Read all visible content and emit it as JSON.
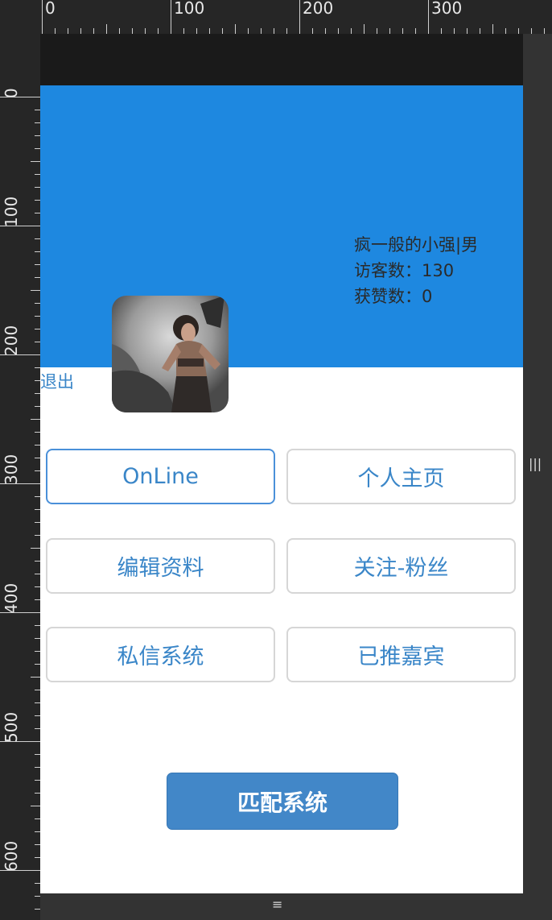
{
  "ruler": {
    "top_labels": [
      "0",
      "100",
      "200",
      "300"
    ],
    "left_labels": [
      "0",
      "100",
      "200",
      "300",
      "400",
      "500",
      "600"
    ]
  },
  "profile": {
    "name_gender": "疯一般的小强|男",
    "visitors": "访客数：130",
    "likes": "获赞数：0",
    "avatar": "warrior-woman-avatar"
  },
  "logout_label": "退出",
  "menu": {
    "online": "OnLine",
    "homepage": "个人主页",
    "edit_profile": "编辑资料",
    "follow_fans": "关注-粉丝",
    "private_msg": "私信系统",
    "recommended": "已推嘉宾"
  },
  "match_button": "匹配系统",
  "colors": {
    "hero": "#1e88e0",
    "accent_text": "#3a86c8",
    "primary_button": "#4287c8"
  },
  "handles": {
    "side": "|||",
    "bottom": "≡"
  }
}
